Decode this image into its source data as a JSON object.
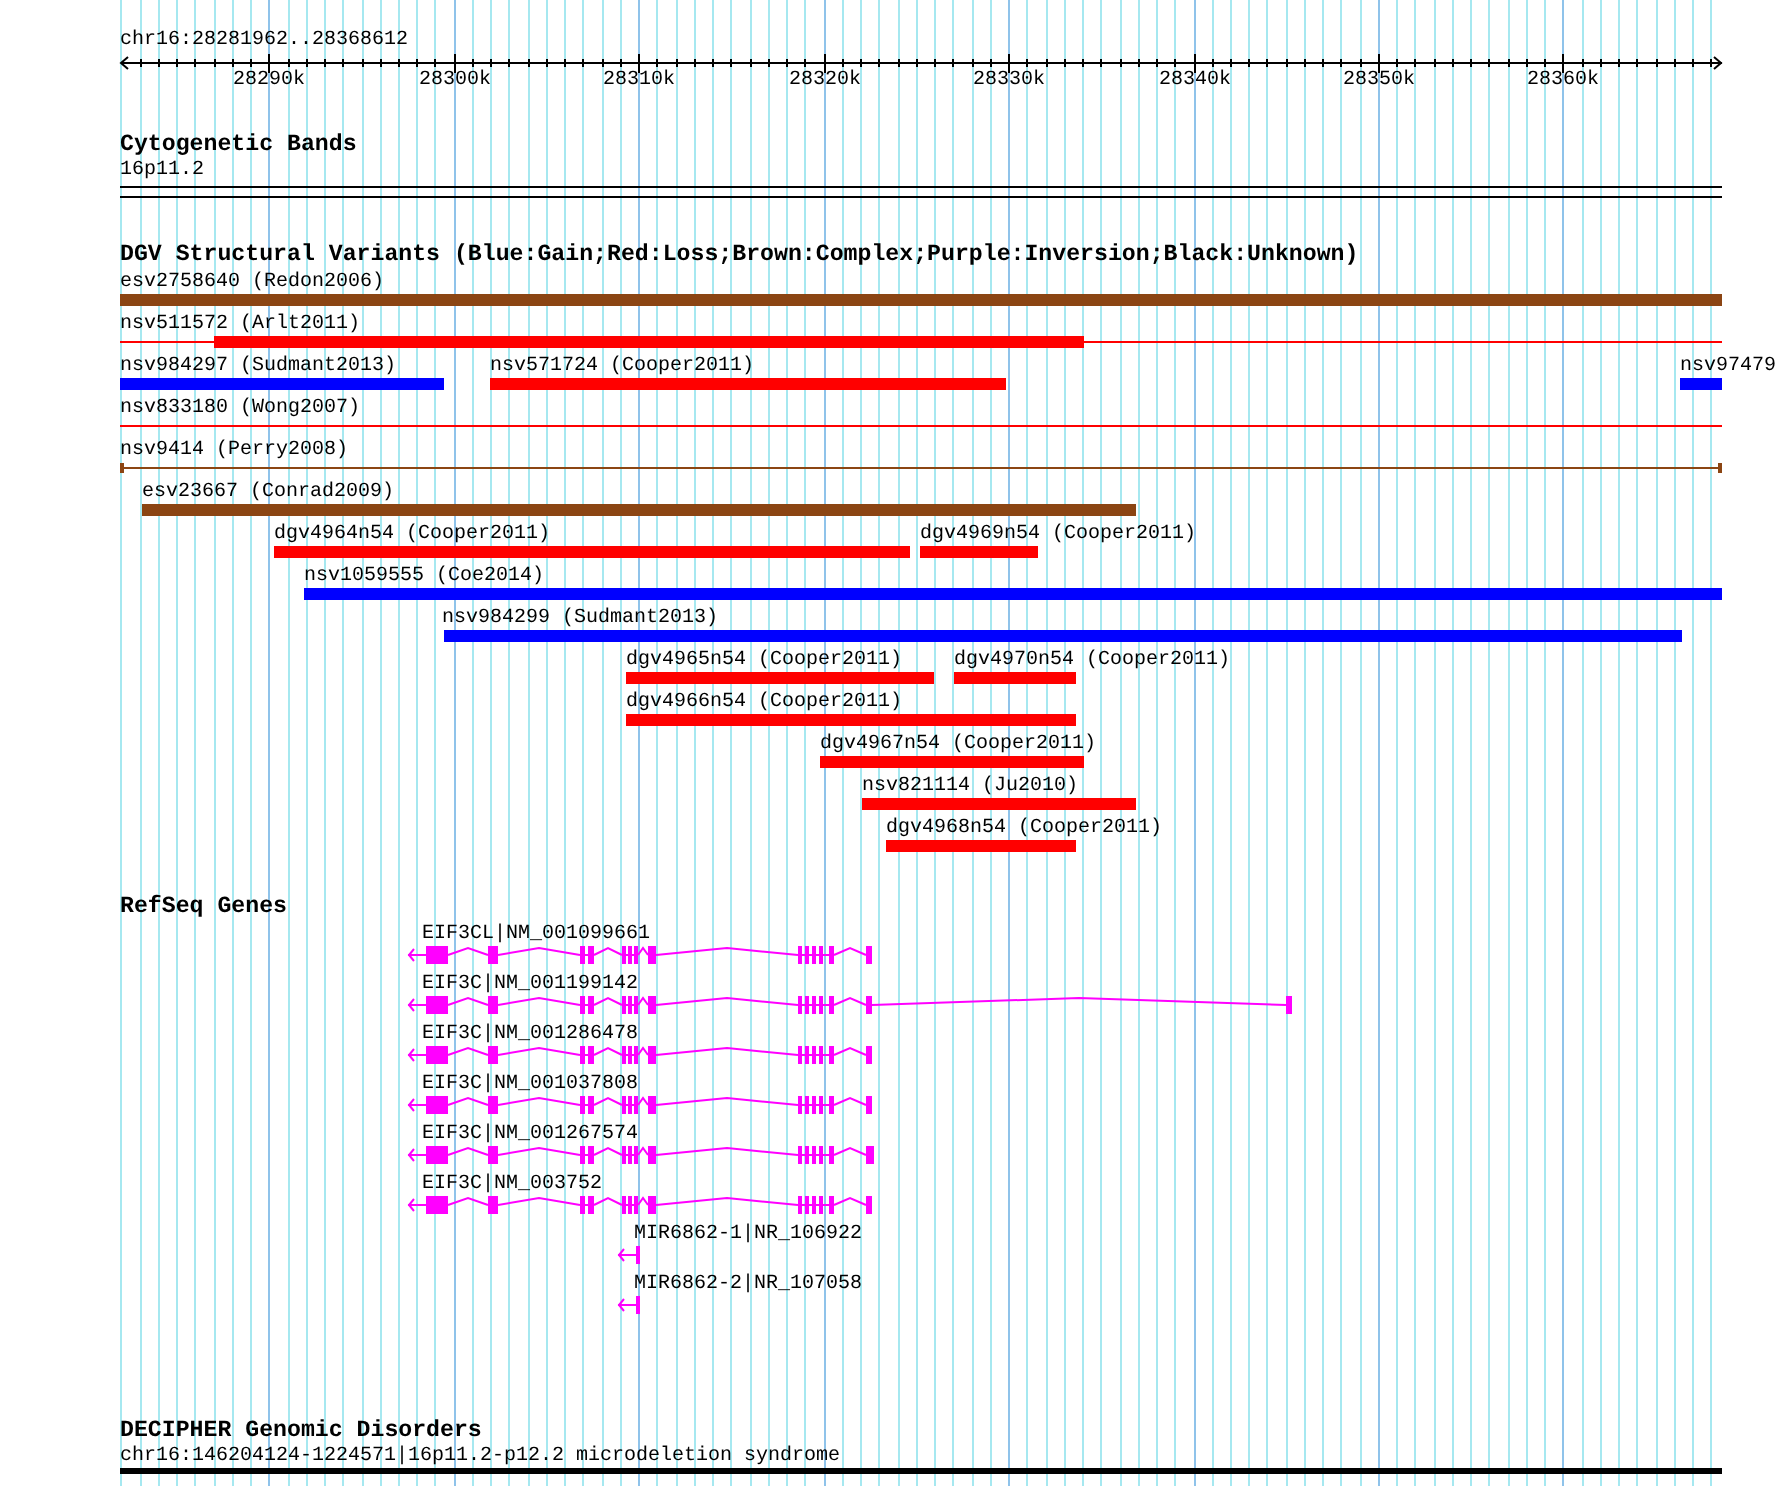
{
  "ruler": {
    "location": "chr16:28281962..28368612",
    "ticks": [
      "28290k",
      "28300k",
      "28310k",
      "28320k",
      "28330k",
      "28340k",
      "28350k",
      "28360k"
    ]
  },
  "tracks": [
    {
      "kind": "cytobands",
      "title": "Cytogenetic Bands",
      "features": [
        {
          "label": "16p11.2"
        }
      ]
    },
    {
      "kind": "variants",
      "title": "DGV Structural Variants (Blue:Gain;Red:Loss;Brown:Complex;Purple:Inversion;Black:Unknown)",
      "features": [
        {
          "label": "esv2758640 (Redon2006)",
          "color": "#8b4513"
        },
        {
          "label": "nsv511572 (Arlt2011)",
          "color": "#ff0000"
        },
        {
          "label": "nsv984297 (Sudmant2013)",
          "color": "#0000ff"
        },
        {
          "label": "nsv571724 (Cooper2011)",
          "color": "#ff0000"
        },
        {
          "label": "nsv97479",
          "color": "#0000ff"
        },
        {
          "label": "nsv833180 (Wong2007)",
          "color": "#ff0000"
        },
        {
          "label": "nsv9414 (Perry2008)",
          "color": "#8b4513"
        },
        {
          "label": "esv23667 (Conrad2009)",
          "color": "#8b4513"
        },
        {
          "label": "dgv4964n54 (Cooper2011)",
          "color": "#ff0000"
        },
        {
          "label": "dgv4969n54 (Cooper2011)",
          "color": "#ff0000"
        },
        {
          "label": "nsv1059555 (Coe2014)",
          "color": "#0000ff"
        },
        {
          "label": "nsv984299 (Sudmant2013)",
          "color": "#0000ff"
        },
        {
          "label": "dgv4965n54 (Cooper2011)",
          "color": "#ff0000"
        },
        {
          "label": "dgv4970n54 (Cooper2011)",
          "color": "#ff0000"
        },
        {
          "label": "dgv4966n54 (Cooper2011)",
          "color": "#ff0000"
        },
        {
          "label": "dgv4967n54 (Cooper2011)",
          "color": "#ff0000"
        },
        {
          "label": "nsv821114 (Ju2010)",
          "color": "#ff0000"
        },
        {
          "label": "dgv4968n54 (Cooper2011)",
          "color": "#ff0000"
        }
      ]
    },
    {
      "kind": "genes",
      "title": "RefSeq Genes",
      "features": [
        {
          "label": "EIF3CL|NM_001099661"
        },
        {
          "label": "EIF3C|NM_001199142"
        },
        {
          "label": "EIF3C|NM_001286478"
        },
        {
          "label": "EIF3C|NM_001037808"
        },
        {
          "label": "EIF3C|NM_001267574"
        },
        {
          "label": "EIF3C|NM_003752"
        },
        {
          "label": "MIR6862-1|NR_106922"
        },
        {
          "label": "MIR6862-2|NR_107058"
        }
      ]
    },
    {
      "kind": "disorders",
      "title": "DECIPHER Genomic Disorders",
      "features": [
        {
          "label": "chr16:146204124-1224571|16p11.2-p12.2 microdeletion syndrome"
        }
      ]
    }
  ]
}
